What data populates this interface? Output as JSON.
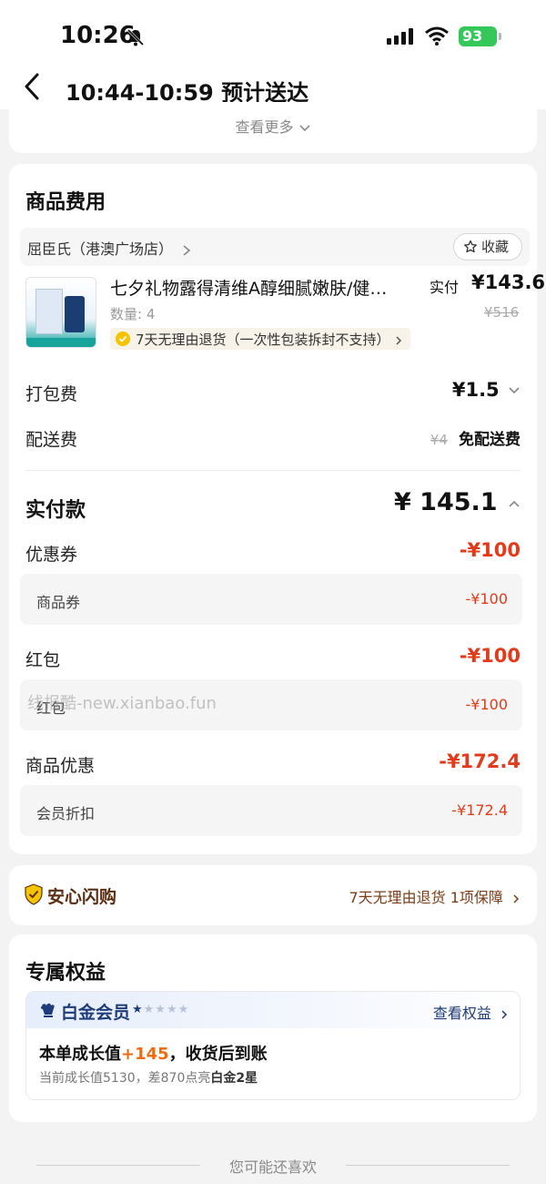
{
  "status_bar": {
    "time": "10:26",
    "battery": "93"
  },
  "nav": {
    "title": "10:44-10:59 预计送达"
  },
  "top_card": {
    "see_more": "查看更多"
  },
  "fees": {
    "section_title": "商品费用",
    "store_name": "屈臣氏（港澳广场店）",
    "favorite_label": "收藏",
    "product": {
      "name": "七夕礼物露得清维A醇细腻嫩肤/健…",
      "quantity": "数量: 4",
      "return_policy": "7天无理由退货（一次性包装拆封不支持）",
      "price_label": "实付",
      "price": "¥143.6",
      "original_price": "¥516"
    },
    "packing": {
      "label": "打包费",
      "value": "¥1.5"
    },
    "delivery": {
      "label": "配送费",
      "original": "¥4",
      "value": "免配送费"
    },
    "total": {
      "label": "实付款",
      "value": "¥ 145.1"
    },
    "coupon": {
      "label": "优惠券",
      "value": "-¥100",
      "sub_label": "商品券",
      "sub_value": "-¥100"
    },
    "red_packet": {
      "label": "红包",
      "value": "-¥100",
      "sub_label": "红包",
      "sub_value": "-¥100"
    },
    "product_discount": {
      "label": "商品优惠",
      "value": "-¥172.4",
      "sub_label": "会员折扣",
      "sub_value": "-¥172.4"
    },
    "watermark": "线报酷-new.xianbao.fun"
  },
  "assurance": {
    "title": "安心闪购",
    "detail": "7天无理由退货 1项保障"
  },
  "benefits": {
    "section_title": "专属权益",
    "tier": "白金会员",
    "stars_on": "★",
    "stars_off": "★★★★",
    "view_link": "查看权益",
    "growth_prefix": "本单成长值",
    "growth_value": "+145",
    "growth_suffix": "，收货后到账",
    "note_prefix": "当前成长值5130，差870点亮",
    "note_highlight": "白金2星"
  },
  "recommend": {
    "label": "您可能还喜欢"
  },
  "colors": {
    "discount_red": "#e33a1a",
    "assurance_brown": "#5c2d12",
    "vip_blue": "#1f3c7a",
    "growth_orange": "#f06a0f"
  }
}
